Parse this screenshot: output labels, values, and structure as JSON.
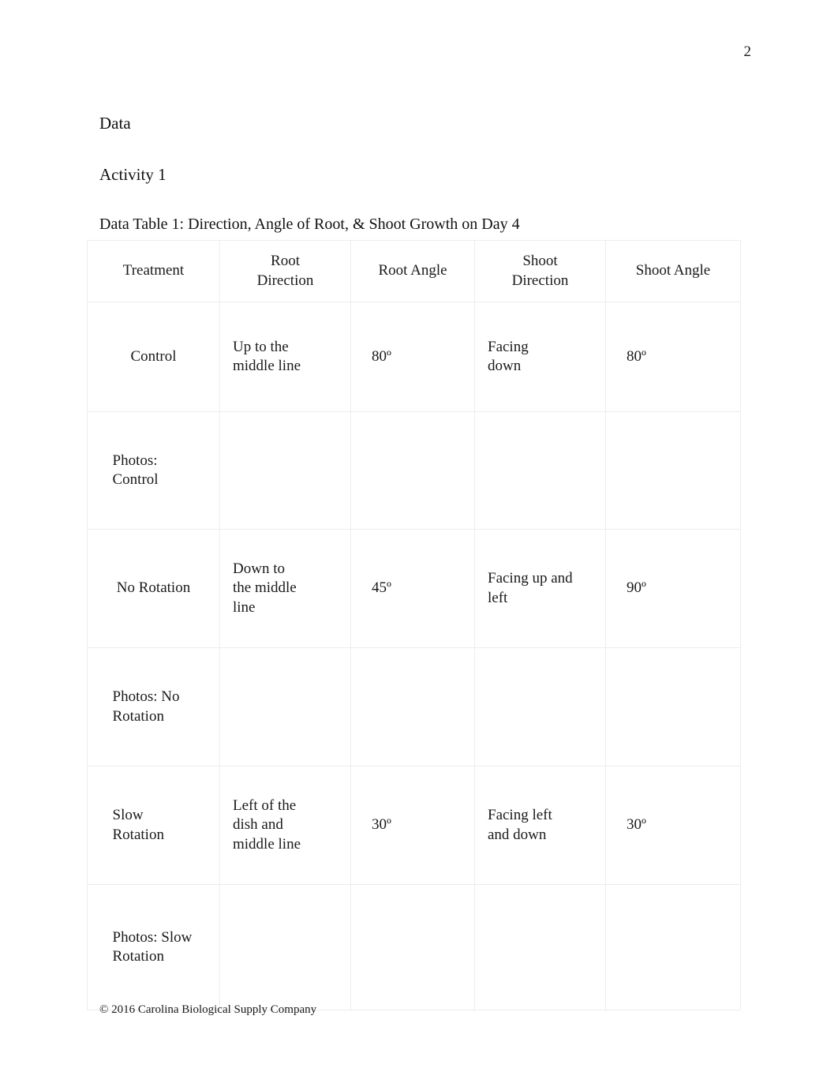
{
  "document": {
    "page_number": "2",
    "section_heading": "Data",
    "activity_heading": "Activity 1",
    "table_caption": "Data Table 1: Direction, Angle of Root, & Shoot Growth on Day 4",
    "footer": "© 2016 Carolina Biological Supply Company"
  },
  "colors": {
    "text": "#1a1a1a",
    "entry_blue": "#1f7ac2",
    "grid_line": "#eceded",
    "page_background": "#ffffff"
  },
  "table": {
    "headers": [
      "Treatment",
      "Root Direction",
      "Root Angle",
      "Shoot Direction",
      "Shoot Angle"
    ],
    "rows": [
      {
        "treatment": "Control",
        "root_direction": "Up to the middle line",
        "root_angle": "80º",
        "shoot_direction": "Facing down",
        "shoot_angle": "80º"
      },
      {
        "treatment": "Photos: Control",
        "root_direction": "",
        "root_angle": "",
        "shoot_direction": "",
        "shoot_angle": ""
      },
      {
        "treatment": "No Rotation",
        "root_direction": "Down to the middle line",
        "root_angle": "45º",
        "shoot_direction": "Facing up and left",
        "shoot_angle": "90º"
      },
      {
        "treatment": "Photos: No Rotation",
        "root_direction": "",
        "root_angle": "",
        "shoot_direction": "",
        "shoot_angle": ""
      },
      {
        "treatment": "Slow Rotation",
        "root_direction": "Left of the dish and middle line",
        "root_angle": "30º",
        "shoot_direction": "Facing left and down",
        "shoot_angle": "30º"
      },
      {
        "treatment": "Photos: Slow Rotation",
        "root_direction": "",
        "root_angle": "",
        "shoot_direction": "",
        "shoot_angle": ""
      }
    ]
  }
}
